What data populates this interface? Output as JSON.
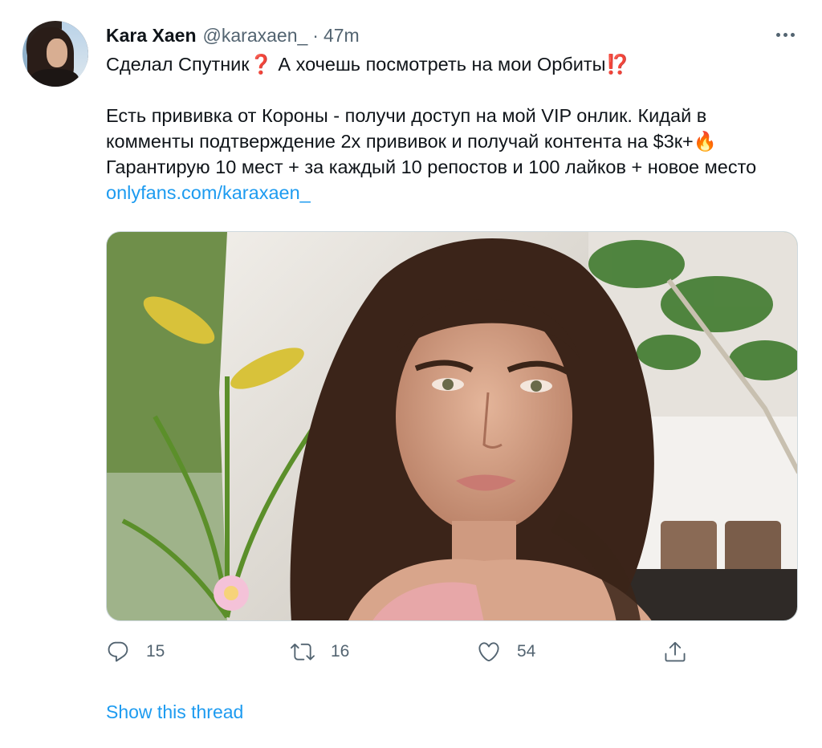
{
  "author": {
    "name": "Kara Xaen",
    "handle": "@karaxaen_",
    "separator": "·",
    "time": "47m"
  },
  "tweet": {
    "line1_text": "Сделал Спутник",
    "line1_emoji1": "❓",
    "line1_mid": " А хочешь посмотреть на мои Орбиты",
    "line1_emoji2": "⁉️",
    "para2_text": "Есть прививка от Короны - получи доступ на мой VIP онлик. Кидай в комменты подтверждение 2х прививок и получай контента на $3к+",
    "para2_emoji": "🔥",
    "para2_cont": " Гарантирую 10 мест + за каждый 10 репостов и 100 лайков + новое место ",
    "link": "onlyfans.com/karaxaen_"
  },
  "actions": {
    "reply_count": "15",
    "retweet_count": "16",
    "like_count": "54"
  },
  "icons": {
    "reply": "reply-icon",
    "retweet": "retweet-icon",
    "like": "heart-icon",
    "share": "share-icon",
    "more": "more-icon"
  },
  "footer": {
    "show_thread": "Show this thread"
  },
  "colors": {
    "link": "#1d9bf0",
    "secondary": "#536471",
    "text": "#0f1419"
  }
}
